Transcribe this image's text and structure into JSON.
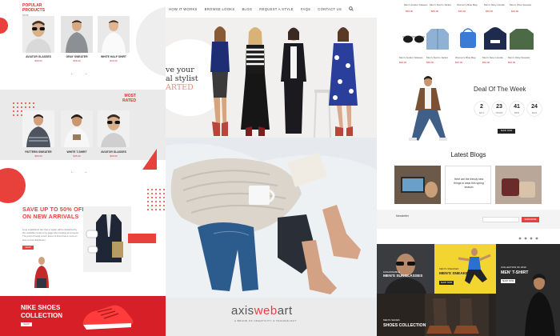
{
  "left": {
    "popular": {
      "title": "POPULAR PRODUCTS",
      "more": "More"
    },
    "popular_items": [
      {
        "name": "AVIATOR GLASSES",
        "price": "$99.00"
      },
      {
        "name": "GRAY SWEATER",
        "price": "$65.00"
      },
      {
        "name": "WHITE HALF SHIRT",
        "price": "$39.00"
      }
    ],
    "most_rated": {
      "title": "MOST RATED"
    },
    "rated_items": [
      {
        "name": "PATTERN SWEATER",
        "price": "$69.00"
      },
      {
        "name": "WHITE T-SHIRT",
        "price": "$35.00"
      },
      {
        "name": "AVIATOR GLASSES",
        "price": "$99.00"
      }
    ],
    "arrows": "← →",
    "sale": {
      "title": "SAVE UP TO 50% OFF ON NEW ARRIVALS",
      "body": "Long established fact that a reader will be distracted by the readable content of a page when looking at its layout. The point of using Lorem Ipsum is that it has a more-or-less normal distribution.",
      "button": "SHOP NOW"
    },
    "nike": {
      "title": "NIKE SHOES COLLECTION",
      "button": "SHOP NOW"
    },
    "colors": {
      "accent": "#e8413c",
      "nike_bg": "#d61f26"
    }
  },
  "mid": {
    "nav": [
      "HOW IT WORKS",
      "BROWSE LOOKS",
      "BLOG",
      "REQUEST A STYLE",
      "FAQS",
      "CONTACT US"
    ],
    "hero": {
      "line1": "ve your",
      "line2": "al stylist",
      "line3": "ARTED"
    },
    "brand": {
      "a": "axis",
      "b": "web",
      "c": "art",
      "tagline": "A BRAND OF CREATIVITY & TECHNOLOGY"
    }
  },
  "right": {
    "top_products": [
      {
        "name": "Men's Aviator Glasses",
        "price": "$99.00"
      },
      {
        "name": "Men's Denim Jacket",
        "price": "$89.00"
      },
      {
        "name": "Women's Blue Bag",
        "price": "$45.00"
      },
      {
        "name": "Men's Navy Hoodie",
        "price": "$59.00"
      },
      {
        "name": "Men's Olive Sweater",
        "price": "$49.00"
      }
    ],
    "deal": {
      "title": "Deal Of The Week",
      "countdown": [
        {
          "value": "2",
          "label": "DAYS"
        },
        {
          "value": "23",
          "label": "HOURS"
        },
        {
          "value": "41",
          "label": "MINS"
        },
        {
          "value": "24",
          "label": "SECS"
        }
      ],
      "button": "SHOP NOW"
    },
    "blogs": {
      "title": "Latest Blogs",
      "note": "Here are the trendy new things to wear this spring season"
    },
    "newsletter": {
      "label": "Newsletter",
      "button": "SUBSCRIBE"
    },
    "tiles": {
      "sunglasses": {
        "small": "FASHIONABLE",
        "big": "MEN'S SUNGLASSES",
        "button": "SHOP NOW"
      },
      "sneakers": {
        "small": "MEN'S SNEAKER",
        "big": "MEN'S SNEAKERS",
        "button": "SHOP NOW"
      },
      "tshirt": {
        "small": "COLLECTION OF 2019",
        "big": "MEN' T-SHIRT",
        "button": "SHOP NOW"
      },
      "shoes": {
        "small": "MEN'S SHOES",
        "big": "SHOES COLLECTION"
      }
    },
    "colors": {
      "yellow": "#f2d531",
      "dark": "#2b2b2b"
    }
  }
}
